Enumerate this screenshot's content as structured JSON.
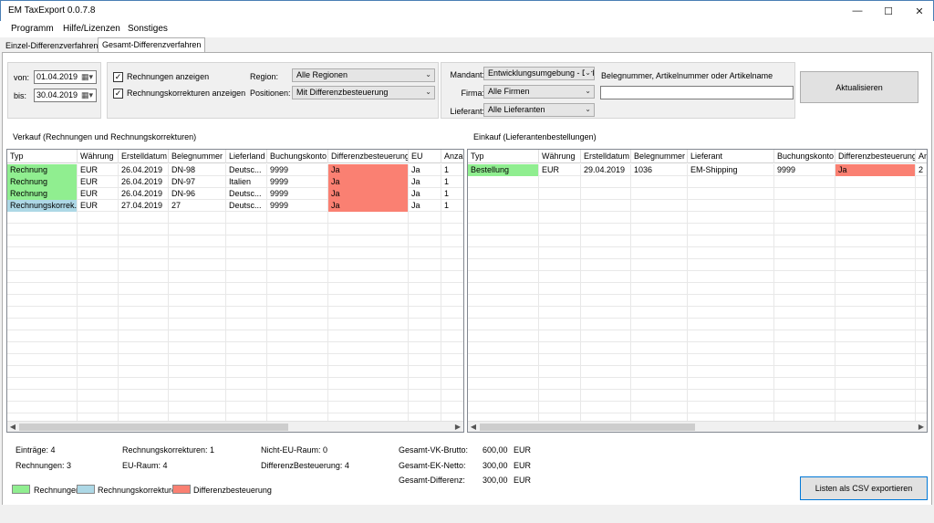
{
  "window": {
    "title": "EM TaxExport 0.0.7.8"
  },
  "menu": [
    "Programm",
    "Hilfe/Lizenzen",
    "Sonstiges"
  ],
  "tabs": [
    "Einzel-Differenzverfahren",
    "Gesamt-Differenzverfahren"
  ],
  "filters": {
    "von_label": "von:",
    "von_value": "01.04.2019",
    "bis_label": "bis:",
    "bis_value": "30.04.2019",
    "check_rechnungen": "Rechnungen anzeigen",
    "check_korrekturen": "Rechnungskorrekturen anzeigen",
    "region_label": "Region:",
    "region_value": "Alle Regionen",
    "positionen_label": "Positionen:",
    "positionen_value": "Mit Differenzbesteuerung",
    "mandant_label": "Mandant:",
    "mandant_value": "Entwicklungsumgebung - Dirk",
    "firma_label": "Firma:",
    "firma_value": "Alle Firmen",
    "lieferant_label": "Lieferant:",
    "lieferant_value": "Alle Lieferanten",
    "search_label": "Belegnummer, Artikelnummer oder Artikelname",
    "refresh_label": "Aktualisieren"
  },
  "verkauf": {
    "title": "Verkauf (Rechnungen und Rechnungskorrekturen)",
    "columns": [
      "Typ",
      "Währung",
      "Erstelldatum",
      "Belegnummer",
      "Lieferland",
      "Buchungskonto",
      "Differenzbesteuerung",
      "EU",
      "Anzahl"
    ],
    "rows": [
      [
        "Rechnung",
        "EUR",
        "26.04.2019",
        "DN-98",
        "Deutsc...",
        "9999",
        "Ja",
        "Ja",
        "1"
      ],
      [
        "Rechnung",
        "EUR",
        "26.04.2019",
        "DN-97",
        "Italien",
        "9999",
        "Ja",
        "Ja",
        "1"
      ],
      [
        "Rechnung",
        "EUR",
        "26.04.2019",
        "DN-96",
        "Deutsc...",
        "9999",
        "Ja",
        "Ja",
        "1"
      ],
      [
        "Rechnungskorrek...",
        "EUR",
        "27.04.2019",
        "27",
        "Deutsc...",
        "9999",
        "Ja",
        "Ja",
        "1"
      ]
    ],
    "row_types": [
      "green",
      "green",
      "green",
      "blue"
    ]
  },
  "einkauf": {
    "title": "Einkauf (Lieferantenbestellungen)",
    "columns": [
      "Typ",
      "Währung",
      "Erstelldatum",
      "Belegnummer",
      "Lieferant",
      "Buchungskonto",
      "Differenzbesteuerung",
      "An"
    ],
    "rows": [
      [
        "Bestellung",
        "EUR",
        "29.04.2019",
        "1036",
        "EM-Shipping",
        "9999",
        "Ja",
        "2"
      ]
    ]
  },
  "summary": {
    "eintraege": "Einträge: 4",
    "rechnungen": "Rechnungen: 3",
    "korrekturen": "Rechnungskorrekturen: 1",
    "eu_raum": "EU-Raum: 4",
    "nicht_eu": "Nicht-EU-Raum: 0",
    "diff": "DifferenzBesteuerung: 4",
    "vk_label": "Gesamt-VK-Brutto:",
    "vk_value": "600,00",
    "vk_cur": "EUR",
    "ek_label": "Gesamt-EK-Netto:",
    "ek_value": "300,00",
    "ek_cur": "EUR",
    "gd_label": "Gesamt-Differenz:",
    "gd_value": "300,00",
    "gd_cur": "EUR"
  },
  "legend": {
    "rechnungen": "Rechnungen",
    "korrekturen": "Rechnungskorrekturen",
    "diff": "Differenzbesteuerung"
  },
  "export_label": "Listen als CSV exportieren",
  "colors": {
    "rechnung": "#90ee90",
    "korrektur": "#add8e6",
    "differenz": "#fa8072"
  }
}
